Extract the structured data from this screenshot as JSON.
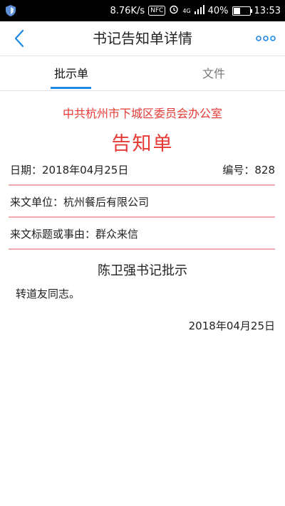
{
  "status_bar": {
    "speed": "8.76K/s",
    "nfc": "NFC",
    "network": "4G",
    "battery": "40%",
    "battery_level": 0.4,
    "time": "13:53"
  },
  "header": {
    "title": "书记告知单详情"
  },
  "tabs": [
    {
      "label": "批示单",
      "active": true
    },
    {
      "label": "文件",
      "active": false
    }
  ],
  "document": {
    "office": "中共杭州市下城区委员会办公室",
    "heading": "告知单",
    "date_label": "日期：2018年04月25日",
    "number_label": "编号：828",
    "sender_label": "来文单位：杭州餐后有限公司",
    "subject_label": "来文标题或事由：群众来信",
    "instruction_title": "陈卫强书记批示",
    "instruction_text": "转道友同志。",
    "instruction_date": "2018年04月25日"
  },
  "colors": {
    "accent": "#1e88e5",
    "red_text": "#e53935",
    "divider": "#f2aab0"
  }
}
